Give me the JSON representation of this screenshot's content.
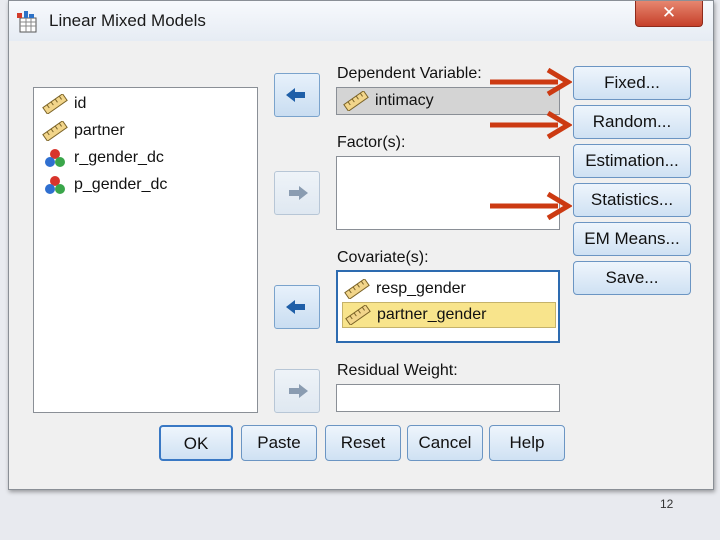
{
  "window": {
    "title": "Linear Mixed Models",
    "close_glyph": "✕"
  },
  "variables": [
    {
      "name": "id",
      "icon": "scale-ruler-icon"
    },
    {
      "name": "partner",
      "icon": "scale-ruler-icon"
    },
    {
      "name": "r_gender_dc",
      "icon": "nominal-balls-icon"
    },
    {
      "name": "p_gender_dc",
      "icon": "nominal-balls-icon"
    }
  ],
  "dependent": {
    "label": "Dependent Variable:",
    "value": "intimacy"
  },
  "factors": {
    "label": "Factor(s):"
  },
  "covariates": {
    "label": "Covariate(s):",
    "items": [
      "resp_gender",
      "partner_gender"
    ]
  },
  "residual_weight": {
    "label": "Residual Weight:"
  },
  "side_buttons": {
    "fixed": "Fixed...",
    "random": "Random...",
    "estimation": "Estimation...",
    "statistics": "Statistics...",
    "em_means": "EM Means...",
    "save": "Save..."
  },
  "bottom_buttons": {
    "ok": "OK",
    "paste": "Paste",
    "reset": "Reset",
    "cancel": "Cancel",
    "help": "Help"
  },
  "annotation_color": "#cc3a12",
  "page_number": "12"
}
